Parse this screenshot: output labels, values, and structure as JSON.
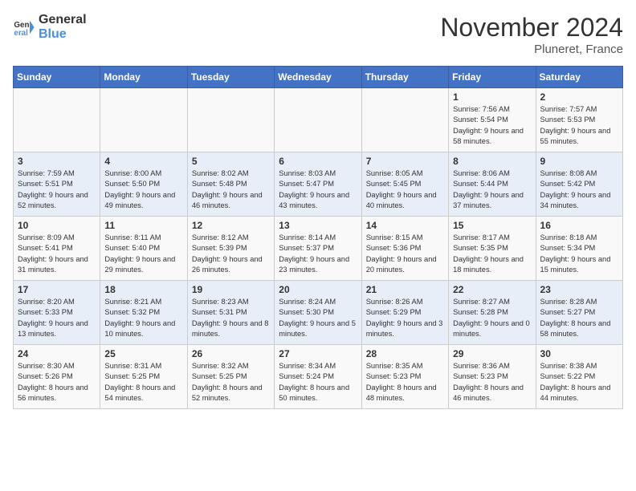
{
  "header": {
    "logo_line1": "General",
    "logo_line2": "Blue",
    "month": "November 2024",
    "location": "Pluneret, France"
  },
  "weekdays": [
    "Sunday",
    "Monday",
    "Tuesday",
    "Wednesday",
    "Thursday",
    "Friday",
    "Saturday"
  ],
  "weeks": [
    [
      {
        "day": "",
        "info": ""
      },
      {
        "day": "",
        "info": ""
      },
      {
        "day": "",
        "info": ""
      },
      {
        "day": "",
        "info": ""
      },
      {
        "day": "",
        "info": ""
      },
      {
        "day": "1",
        "info": "Sunrise: 7:56 AM\nSunset: 5:54 PM\nDaylight: 9 hours and 58 minutes."
      },
      {
        "day": "2",
        "info": "Sunrise: 7:57 AM\nSunset: 5:53 PM\nDaylight: 9 hours and 55 minutes."
      }
    ],
    [
      {
        "day": "3",
        "info": "Sunrise: 7:59 AM\nSunset: 5:51 PM\nDaylight: 9 hours and 52 minutes."
      },
      {
        "day": "4",
        "info": "Sunrise: 8:00 AM\nSunset: 5:50 PM\nDaylight: 9 hours and 49 minutes."
      },
      {
        "day": "5",
        "info": "Sunrise: 8:02 AM\nSunset: 5:48 PM\nDaylight: 9 hours and 46 minutes."
      },
      {
        "day": "6",
        "info": "Sunrise: 8:03 AM\nSunset: 5:47 PM\nDaylight: 9 hours and 43 minutes."
      },
      {
        "day": "7",
        "info": "Sunrise: 8:05 AM\nSunset: 5:45 PM\nDaylight: 9 hours and 40 minutes."
      },
      {
        "day": "8",
        "info": "Sunrise: 8:06 AM\nSunset: 5:44 PM\nDaylight: 9 hours and 37 minutes."
      },
      {
        "day": "9",
        "info": "Sunrise: 8:08 AM\nSunset: 5:42 PM\nDaylight: 9 hours and 34 minutes."
      }
    ],
    [
      {
        "day": "10",
        "info": "Sunrise: 8:09 AM\nSunset: 5:41 PM\nDaylight: 9 hours and 31 minutes."
      },
      {
        "day": "11",
        "info": "Sunrise: 8:11 AM\nSunset: 5:40 PM\nDaylight: 9 hours and 29 minutes."
      },
      {
        "day": "12",
        "info": "Sunrise: 8:12 AM\nSunset: 5:39 PM\nDaylight: 9 hours and 26 minutes."
      },
      {
        "day": "13",
        "info": "Sunrise: 8:14 AM\nSunset: 5:37 PM\nDaylight: 9 hours and 23 minutes."
      },
      {
        "day": "14",
        "info": "Sunrise: 8:15 AM\nSunset: 5:36 PM\nDaylight: 9 hours and 20 minutes."
      },
      {
        "day": "15",
        "info": "Sunrise: 8:17 AM\nSunset: 5:35 PM\nDaylight: 9 hours and 18 minutes."
      },
      {
        "day": "16",
        "info": "Sunrise: 8:18 AM\nSunset: 5:34 PM\nDaylight: 9 hours and 15 minutes."
      }
    ],
    [
      {
        "day": "17",
        "info": "Sunrise: 8:20 AM\nSunset: 5:33 PM\nDaylight: 9 hours and 13 minutes."
      },
      {
        "day": "18",
        "info": "Sunrise: 8:21 AM\nSunset: 5:32 PM\nDaylight: 9 hours and 10 minutes."
      },
      {
        "day": "19",
        "info": "Sunrise: 8:23 AM\nSunset: 5:31 PM\nDaylight: 9 hours and 8 minutes."
      },
      {
        "day": "20",
        "info": "Sunrise: 8:24 AM\nSunset: 5:30 PM\nDaylight: 9 hours and 5 minutes."
      },
      {
        "day": "21",
        "info": "Sunrise: 8:26 AM\nSunset: 5:29 PM\nDaylight: 9 hours and 3 minutes."
      },
      {
        "day": "22",
        "info": "Sunrise: 8:27 AM\nSunset: 5:28 PM\nDaylight: 9 hours and 0 minutes."
      },
      {
        "day": "23",
        "info": "Sunrise: 8:28 AM\nSunset: 5:27 PM\nDaylight: 8 hours and 58 minutes."
      }
    ],
    [
      {
        "day": "24",
        "info": "Sunrise: 8:30 AM\nSunset: 5:26 PM\nDaylight: 8 hours and 56 minutes."
      },
      {
        "day": "25",
        "info": "Sunrise: 8:31 AM\nSunset: 5:25 PM\nDaylight: 8 hours and 54 minutes."
      },
      {
        "day": "26",
        "info": "Sunrise: 8:32 AM\nSunset: 5:25 PM\nDaylight: 8 hours and 52 minutes."
      },
      {
        "day": "27",
        "info": "Sunrise: 8:34 AM\nSunset: 5:24 PM\nDaylight: 8 hours and 50 minutes."
      },
      {
        "day": "28",
        "info": "Sunrise: 8:35 AM\nSunset: 5:23 PM\nDaylight: 8 hours and 48 minutes."
      },
      {
        "day": "29",
        "info": "Sunrise: 8:36 AM\nSunset: 5:23 PM\nDaylight: 8 hours and 46 minutes."
      },
      {
        "day": "30",
        "info": "Sunrise: 8:38 AM\nSunset: 5:22 PM\nDaylight: 8 hours and 44 minutes."
      }
    ]
  ]
}
